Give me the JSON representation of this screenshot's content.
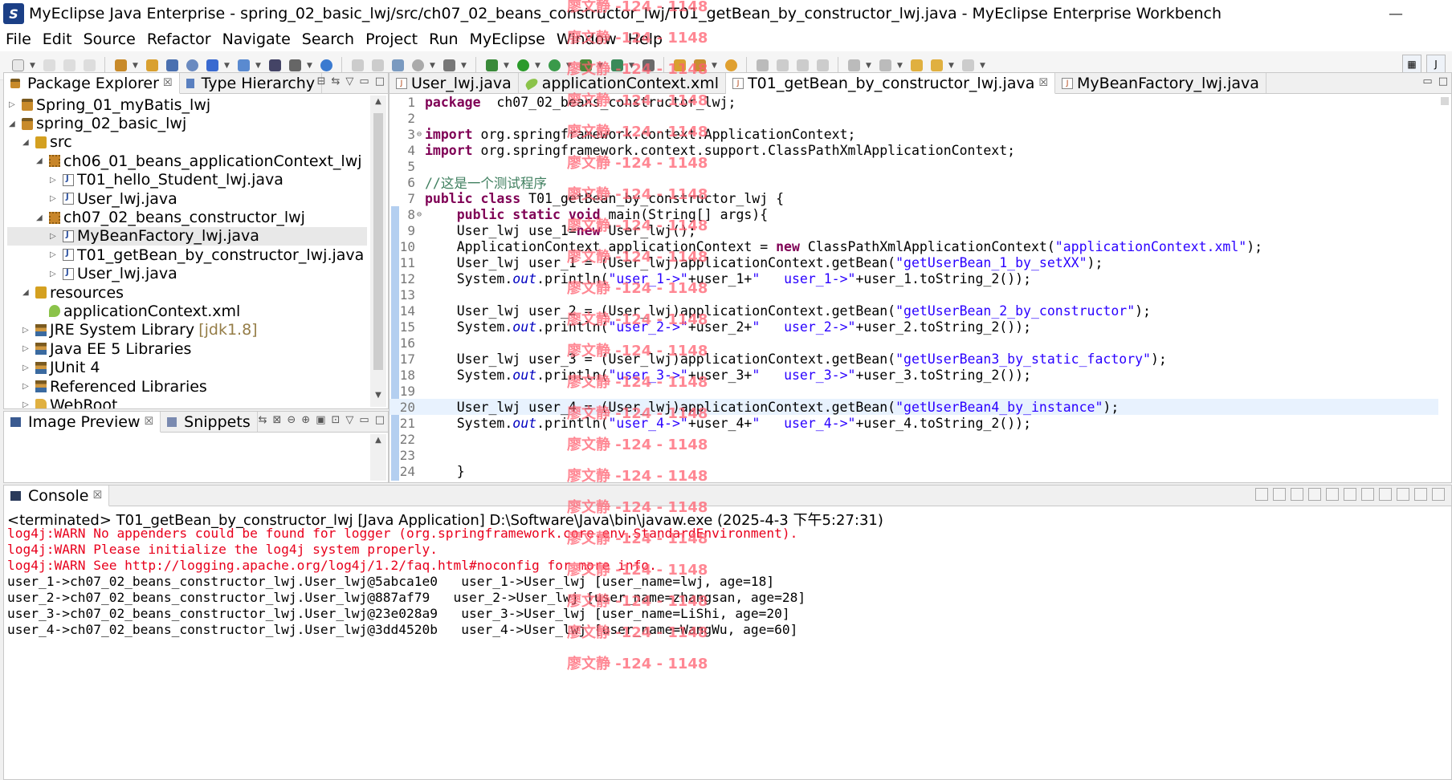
{
  "window": {
    "title": "MyEclipse Java Enterprise - spring_02_basic_lwj/src/ch07_02_beans_constructor_lwj/T01_getBean_by_constructor_lwj.java - MyEclipse Enterprise Workbench",
    "app_icon": "S",
    "minimize": "—"
  },
  "menu": [
    "File",
    "Edit",
    "Source",
    "Refactor",
    "Navigate",
    "Search",
    "Project",
    "Run",
    "MyEclipse",
    "Window",
    "Help"
  ],
  "package_explorer": {
    "tab_label": "Package Explorer",
    "tab2_label": "Type Hierarchy",
    "items": [
      {
        "label": "Spring_01_myBatis_lwj",
        "icon": "project-icon",
        "indent": 0,
        "twisty": "▷"
      },
      {
        "label": "spring_02_basic_lwj",
        "icon": "project-icon",
        "indent": 0,
        "twisty": "◢"
      },
      {
        "label": "src",
        "icon": "src-folder-icon",
        "indent": 1,
        "twisty": "◢"
      },
      {
        "label": "ch06_01_beans_applicationContext_lwj",
        "icon": "package-icon",
        "indent": 2,
        "twisty": "◢"
      },
      {
        "label": "T01_hello_Student_lwj.java",
        "icon": "java-file-icon",
        "indent": 3,
        "twisty": "▷"
      },
      {
        "label": "User_lwj.java",
        "icon": "java-file-icon",
        "indent": 3,
        "twisty": "▷"
      },
      {
        "label": "ch07_02_beans_constructor_lwj",
        "icon": "package-icon",
        "indent": 2,
        "twisty": "◢"
      },
      {
        "label": "MyBeanFactory_lwj.java",
        "icon": "java-file-icon",
        "indent": 3,
        "twisty": "▷",
        "selected": true
      },
      {
        "label": "T01_getBean_by_constructor_lwj.java",
        "icon": "java-file-icon",
        "indent": 3,
        "twisty": "▷"
      },
      {
        "label": "User_lwj.java",
        "icon": "java-file-icon",
        "indent": 3,
        "twisty": "▷"
      },
      {
        "label": "resources",
        "icon": "src-folder-icon",
        "indent": 1,
        "twisty": "◢"
      },
      {
        "label": "applicationContext.xml",
        "icon": "xml-file-icon",
        "indent": 2,
        "twisty": ""
      },
      {
        "label": "JRE System Library",
        "suffix": "[jdk1.8]",
        "icon": "library-icon",
        "indent": 1,
        "twisty": "▷"
      },
      {
        "label": "Java EE 5 Libraries",
        "icon": "library-icon",
        "indent": 1,
        "twisty": "▷"
      },
      {
        "label": "JUnit 4",
        "icon": "library-icon",
        "indent": 1,
        "twisty": "▷"
      },
      {
        "label": "Referenced Libraries",
        "icon": "library-icon",
        "indent": 1,
        "twisty": "▷"
      },
      {
        "label": "WebRoot",
        "icon": "folder-icon",
        "indent": 1,
        "twisty": "▷"
      }
    ]
  },
  "image_preview": {
    "tab_label": "Image Preview",
    "tab2_label": "Snippets"
  },
  "editor": {
    "tabs": [
      {
        "label": "User_lwj.java",
        "icon": "java"
      },
      {
        "label": "applicationContext.xml",
        "icon": "xml"
      },
      {
        "label": "T01_getBean_by_constructor_lwj.java",
        "icon": "java",
        "active": true
      },
      {
        "label": "MyBeanFactory_lwj.java",
        "icon": "java"
      }
    ],
    "lines": [
      {
        "n": "1",
        "segs": [
          [
            "kw",
            "package"
          ],
          [
            "",
            "  ch07_02_beans_constructor_lwj;"
          ]
        ]
      },
      {
        "n": "2",
        "segs": []
      },
      {
        "n": "3",
        "fold": "⊖",
        "segs": [
          [
            "kw",
            "import"
          ],
          [
            "",
            " org.springframework.context.ApplicationContext;"
          ]
        ]
      },
      {
        "n": "4",
        "segs": [
          [
            "kw",
            "import"
          ],
          [
            "",
            " org.springframework.context.support.ClassPathXmlApplicationContext;"
          ]
        ]
      },
      {
        "n": "5",
        "segs": []
      },
      {
        "n": "6",
        "segs": [
          [
            "cmt",
            "//这是一个测试程序"
          ]
        ]
      },
      {
        "n": "7",
        "segs": [
          [
            "kw",
            "public class"
          ],
          [
            "",
            " T01_getBean_by_constructor_lwj {"
          ]
        ]
      },
      {
        "n": "8",
        "fold": "⊖",
        "segs": [
          [
            "",
            "    "
          ],
          [
            "kw",
            "public static void"
          ],
          [
            "",
            " main(String[] args){"
          ]
        ]
      },
      {
        "n": "9",
        "segs": [
          [
            "",
            "    User_lwj use_1="
          ],
          [
            "kw",
            "new"
          ],
          [
            "",
            " User_lwj();"
          ]
        ]
      },
      {
        "n": "10",
        "segs": [
          [
            "",
            "    ApplicationContext applicationContext = "
          ],
          [
            "kw",
            "new"
          ],
          [
            "",
            " ClassPathXmlApplicationContext("
          ],
          [
            "str",
            "\"applicationContext.xml\""
          ],
          [
            "",
            ");"
          ]
        ]
      },
      {
        "n": "11",
        "segs": [
          [
            "",
            "    User_lwj user_1 = (User_lwj)applicationContext.getBean("
          ],
          [
            "str",
            "\"getUserBean_1_by_setXX\""
          ],
          [
            "",
            ");"
          ]
        ]
      },
      {
        "n": "12",
        "segs": [
          [
            "",
            "    System."
          ],
          [
            "fld",
            "out"
          ],
          [
            "",
            ".println("
          ],
          [
            "str",
            "\"user_1->\""
          ],
          [
            "",
            "+user_1+"
          ],
          [
            "str",
            "\"   user_1->\""
          ],
          [
            "",
            "+user_1.toString_2());"
          ]
        ]
      },
      {
        "n": "13",
        "segs": []
      },
      {
        "n": "14",
        "segs": [
          [
            "",
            "    User_lwj user_2 = (User_lwj)applicationContext.getBean("
          ],
          [
            "str",
            "\"getUserBean_2_by_constructor\""
          ],
          [
            "",
            ");"
          ]
        ]
      },
      {
        "n": "15",
        "segs": [
          [
            "",
            "    System."
          ],
          [
            "fld",
            "out"
          ],
          [
            "",
            ".println("
          ],
          [
            "str",
            "\"user_2->\""
          ],
          [
            "",
            "+user_2+"
          ],
          [
            "str",
            "\"   user_2->\""
          ],
          [
            "",
            "+user_2.toString_2());"
          ]
        ]
      },
      {
        "n": "16",
        "segs": []
      },
      {
        "n": "17",
        "segs": [
          [
            "",
            "    User_lwj user_3 = (User_lwj)applicationContext.getBean("
          ],
          [
            "str",
            "\"getUserBean3_by_static_factory\""
          ],
          [
            "",
            ");"
          ]
        ]
      },
      {
        "n": "18",
        "segs": [
          [
            "",
            "    System."
          ],
          [
            "fld",
            "out"
          ],
          [
            "",
            ".println("
          ],
          [
            "str",
            "\"user_3->\""
          ],
          [
            "",
            "+user_3+"
          ],
          [
            "str",
            "\"   user_3->\""
          ],
          [
            "",
            "+user_3.toString_2());"
          ]
        ]
      },
      {
        "n": "19",
        "segs": []
      },
      {
        "n": "20",
        "cur": true,
        "segs": [
          [
            "",
            "    User_lwj user_4 = (User_lwj)applicationContext.getBean("
          ],
          [
            "str",
            "\"getUserBean4_by_instance\""
          ],
          [
            "",
            ");"
          ]
        ]
      },
      {
        "n": "21",
        "segs": [
          [
            "",
            "    System."
          ],
          [
            "fld",
            "out"
          ],
          [
            "",
            ".println("
          ],
          [
            "str",
            "\"user_4->\""
          ],
          [
            "",
            "+user_4+"
          ],
          [
            "str",
            "\"   user_4->\""
          ],
          [
            "",
            "+user_4.toString_2());"
          ]
        ]
      },
      {
        "n": "22",
        "segs": []
      },
      {
        "n": "23",
        "segs": []
      },
      {
        "n": "24",
        "segs": [
          [
            "",
            "    }"
          ]
        ]
      }
    ]
  },
  "console": {
    "tab_label": "Console",
    "header": "<terminated> T01_getBean_by_constructor_lwj [Java Application] D:\\Software\\Java\\bin\\javaw.exe (2025-4-3 下午5:27:31)",
    "lines": [
      {
        "err": true,
        "text": "log4j:WARN No appenders could be found for logger (org.springframework.core.env.StandardEnvironment)."
      },
      {
        "err": true,
        "text": "log4j:WARN Please initialize the log4j system properly."
      },
      {
        "err": true,
        "text": "log4j:WARN See http://logging.apache.org/log4j/1.2/faq.html#noconfig for more info."
      },
      {
        "err": false,
        "text": "user_1->ch07_02_beans_constructor_lwj.User_lwj@5abca1e0   user_1->User_lwj [user_name=lwj, age=18]"
      },
      {
        "err": false,
        "text": "user_2->ch07_02_beans_constructor_lwj.User_lwj@887af79   user_2->User_lwj [user_name=zhangsan, age=28]"
      },
      {
        "err": false,
        "text": "user_3->ch07_02_beans_constructor_lwj.User_lwj@23e028a9   user_3->User_lwj [user_name=LiShi, age=20]"
      },
      {
        "err": false,
        "text": "user_4->ch07_02_beans_constructor_lwj.User_lwj@3dd4520b   user_4->User_lwj [user_name=WangWu, age=60]"
      }
    ]
  },
  "watermark": "廖文静 -124 - 1148",
  "colors": {
    "keyword": "#7f0055",
    "string": "#2a00ff",
    "field": "#0000c0",
    "comment": "#3f7f5f",
    "error": "#e8001c",
    "watermark": "#ff6070"
  }
}
